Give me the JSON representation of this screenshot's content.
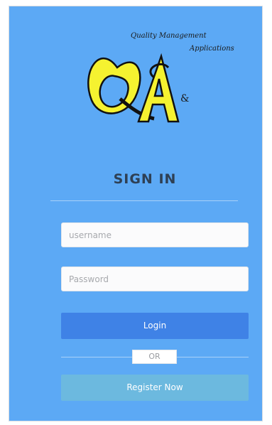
{
  "logo": {
    "tagline_line1": "Quality Management",
    "tagline_line2": "Applications",
    "letters": "QA",
    "ampersand": "&"
  },
  "form": {
    "heading": "SIGN IN",
    "username_placeholder": "username",
    "password_placeholder": "Password",
    "login_label": "Login",
    "or_label": "OR",
    "register_label": "Register Now"
  },
  "colors": {
    "panel_background": "#5ca9f5",
    "login_button": "#3f82e6",
    "register_button": "#6cb9df",
    "logo_yellow": "#f5f230",
    "heading_text": "#2e4055"
  }
}
